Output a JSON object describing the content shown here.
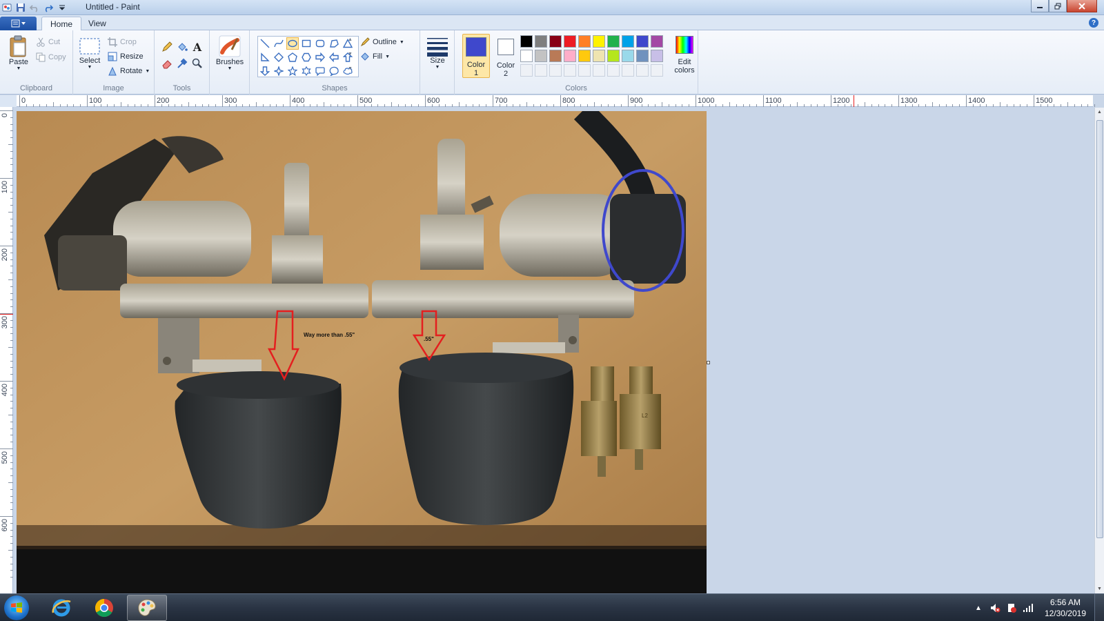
{
  "window": {
    "title": "Untitled - Paint"
  },
  "tabs": [
    {
      "label": "Home"
    },
    {
      "label": "View"
    }
  ],
  "ribbon": {
    "clipboard": {
      "label": "Clipboard",
      "paste": "Paste",
      "cut": "Cut",
      "copy": "Copy"
    },
    "image": {
      "label": "Image",
      "select": "Select",
      "crop": "Crop",
      "resize": "Resize",
      "rotate": "Rotate"
    },
    "tools": {
      "label": "Tools"
    },
    "brushes": {
      "label": "Brushes"
    },
    "shapes": {
      "label": "Shapes",
      "outline": "Outline",
      "fill": "Fill"
    },
    "size": {
      "label": "Size"
    },
    "colors": {
      "label": "Colors",
      "color1_line1": "Color",
      "color1_line2": "1",
      "color2_line1": "Color",
      "color2_line2": "2",
      "edit_line1": "Edit",
      "edit_line2": "colors",
      "color1": "#3f48cc",
      "color2": "#ffffff",
      "row1": [
        "#000000",
        "#7f7f7f",
        "#880015",
        "#ed1c24",
        "#ff7f27",
        "#fff200",
        "#22b14c",
        "#00a2e8",
        "#3f48cc",
        "#a349a4"
      ],
      "row2": [
        "#ffffff",
        "#c3c3c3",
        "#b97a57",
        "#ffaec9",
        "#ffc90e",
        "#efe4b0",
        "#b5e61d",
        "#99d9ea",
        "#7092be",
        "#c8bfe7"
      ]
    }
  },
  "ruler": {
    "h_labels": [
      "0",
      "100",
      "200",
      "300",
      "400",
      "500",
      "600",
      "700",
      "800",
      "900",
      "1000",
      "1100",
      "1200",
      "1300",
      "1400",
      "1500"
    ],
    "v_labels": [
      "0",
      "100",
      "200",
      "300",
      "400",
      "500",
      "600"
    ]
  },
  "canvas": {
    "annotation_left": "Way more than .55\"",
    "annotation_right": ".55\"",
    "part_label": "L2"
  },
  "taskbar": {
    "time": "6:56 AM",
    "date": "12/30/2019"
  }
}
